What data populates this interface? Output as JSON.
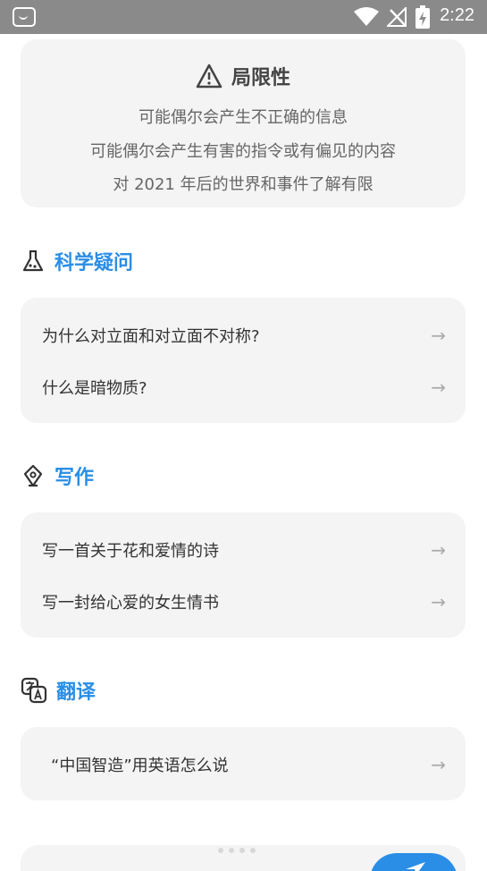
{
  "status_bar": {
    "time": "2:22",
    "icons": [
      "app-notification-icon",
      "wifi-icon",
      "no-signal-icon",
      "battery-charging-icon"
    ]
  },
  "limitations": {
    "title": "局限性",
    "icon": "warning-triangle-icon",
    "lines": [
      "可能偶尔会产生不正确的信息",
      "可能偶尔会产生有害的指令或有偏见的内容",
      "对 2021 年后的世界和事件了解有限"
    ]
  },
  "sections": [
    {
      "title": "科学疑问",
      "icon": "flask-icon",
      "questions": [
        "为什么对立面和对立面不对称?",
        "什么是暗物质?"
      ]
    },
    {
      "title": "写作",
      "icon": "pen-nib-icon",
      "questions": [
        "写一首关于花和爱情的诗",
        "写一封给心爱的女生情书"
      ]
    },
    {
      "title": "翻译",
      "icon": "translate-icon",
      "questions": [
        "“中国智造”用英语怎么说"
      ]
    }
  ],
  "arrow": "→",
  "send_icon": "send-icon",
  "colors": {
    "accent": "#2a8ee6",
    "card_bg": "#f4f4f4",
    "status_bar": "#8a8a8a"
  }
}
